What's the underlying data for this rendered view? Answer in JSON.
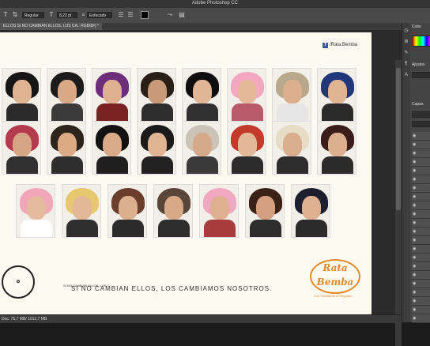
{
  "window": {
    "title": "Adobe Photoshop CC"
  },
  "options_bar": {
    "style_label": "Regular",
    "size_value": "8,22 pt",
    "aa_value": "Enfocado"
  },
  "document": {
    "tab_label": "ELLOS SI NO CAMBIAN ELLOS, LOS CA.. RGB/8#) *"
  },
  "artboard": {
    "facebook_text": "/Rata.Bemba",
    "headline": "SI NO CAMBIAN ELLOS, LOS CAMBIAMOS NOSOTROS.",
    "headline_small": "SI NO CAMBIAN ELLOS, LOS C",
    "stamp_text": "RENOVALAREJUNDEB",
    "logo_text": "Rata Bemba",
    "tagline": "Con Fanatismo al Segundo"
  },
  "photos": [
    {
      "wig": "#151515",
      "skin": "#e0b493",
      "body": "#2b2b2b"
    },
    {
      "wig": "#1b1b1b",
      "skin": "#d9a985",
      "body": "#3b3b3b"
    },
    {
      "wig": "#6e2d7a",
      "skin": "#dfb08f",
      "body": "#7a2222"
    },
    {
      "wig": "#2a1f16",
      "skin": "#c99a79",
      "body": "#2d2d2d"
    },
    {
      "wig": "#0f0f0f",
      "skin": "#e2b596",
      "body": "#303030"
    },
    {
      "wig": "#f4a7c0",
      "skin": "#e5b89a",
      "body": "#b85a6a"
    },
    {
      "wig": "#b9a88b",
      "skin": "#dcb08e",
      "body": "#e6e6e6"
    },
    {
      "wig": "#22377a",
      "skin": "#e0b493",
      "body": "#2a2a2a"
    },
    {
      "wig": "#b43a4d",
      "skin": "#d6a584",
      "body": "#303030"
    },
    {
      "wig": "#2d241b",
      "skin": "#dcab86",
      "body": "#2e2e2e"
    },
    {
      "wig": "#121212",
      "skin": "#d8aa88",
      "body": "#1f1f1f"
    },
    {
      "wig": "#1a1a1a",
      "skin": "#e0b493",
      "body": "#222222"
    },
    {
      "wig": "#cbc3b6",
      "skin": "#d6a98a",
      "body": "#3a3a3a"
    },
    {
      "wig": "#c23a2a",
      "skin": "#e3b899",
      "body": "#2c2c2c"
    },
    {
      "wig": "#e7ddc6",
      "skin": "#d9ad8e",
      "body": "#2d2d2d"
    },
    {
      "wig": "#3a1d1a",
      "skin": "#dcb08f",
      "body": "#2b2b2b"
    },
    {
      "wig": "#f2a7b8",
      "skin": "#e5bba0",
      "body": "#ffffff"
    },
    {
      "wig": "#e8c86e",
      "skin": "#e3b797",
      "body": "#2f2f2f"
    },
    {
      "wig": "#6a3d2d",
      "skin": "#dcb08f",
      "body": "#2b2b2b"
    },
    {
      "wig": "#5a4638",
      "skin": "#d7a987",
      "body": "#2e2e2e"
    },
    {
      "wig": "#f0a8c0",
      "skin": "#dfb090",
      "body": "#a83c3c"
    },
    {
      "wig": "#3b2218",
      "skin": "#d4a080",
      "body": "#2d2d2d"
    },
    {
      "wig": "#1d1e2e",
      "skin": "#dfb090",
      "body": "#2b2b2b"
    }
  ],
  "status_bar": {
    "text": "Doc: 75,7 MB/ 1012,7 MB"
  },
  "right_panel": {
    "tab1": "Color",
    "tab2": "Ajustes",
    "tab3": "Capas"
  }
}
